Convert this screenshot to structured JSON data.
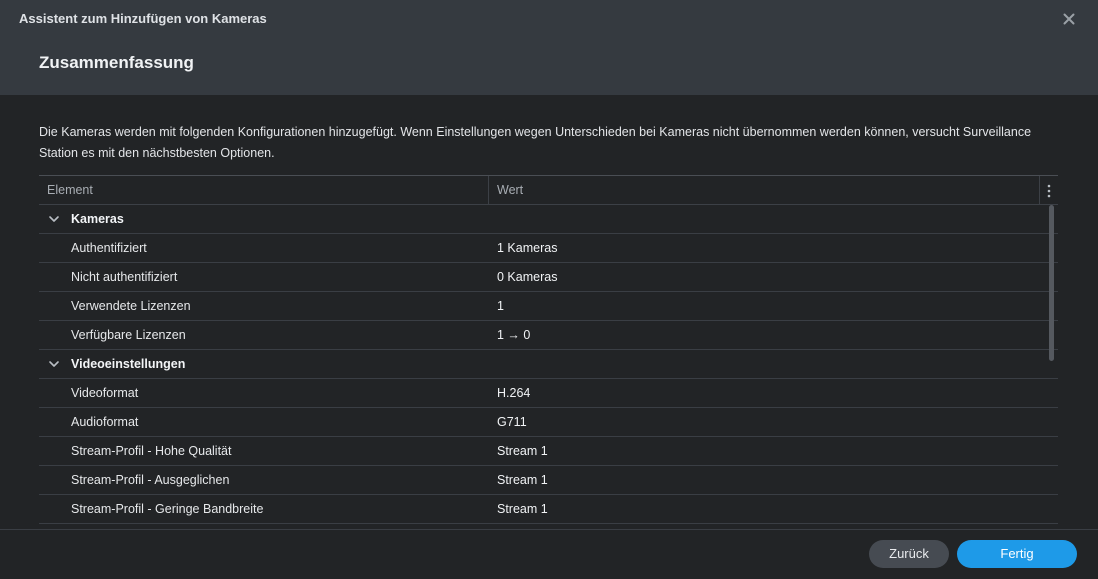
{
  "window": {
    "title": "Assistent zum Hinzufügen von Kameras",
    "close_icon": "close-icon"
  },
  "page": {
    "heading": "Zusammenfassung",
    "description": "Die Kameras werden mit folgenden Konfigurationen hinzugefügt. Wenn Einstellungen wegen Unterschieden bei Kameras nicht übernommen werden können, versucht Surveillance Station es mit den nächstbesten Optionen."
  },
  "table": {
    "columns": {
      "element": "Element",
      "value": "Wert"
    },
    "menu_icon": "more-vertical-icon",
    "groups": [
      {
        "label": "Kameras",
        "rows": [
          {
            "name": "Authentifiziert",
            "value": "1 Kameras"
          },
          {
            "name": "Nicht authentifiziert",
            "value": "0 Kameras"
          },
          {
            "name": "Verwendete Lizenzen",
            "value": "1"
          },
          {
            "name": "Verfügbare Lizenzen",
            "value": "1 → 0"
          }
        ]
      },
      {
        "label": "Videoeinstellungen",
        "rows": [
          {
            "name": "Videoformat",
            "value": "H.264"
          },
          {
            "name": "Audioformat",
            "value": "G711"
          },
          {
            "name": "Stream-Profil - Hohe Qualität",
            "value": "Stream 1"
          },
          {
            "name": "Stream-Profil - Ausgeglichen",
            "value": "Stream 1"
          },
          {
            "name": "Stream-Profil - Geringe Bandbreite",
            "value": "Stream 1"
          }
        ]
      }
    ]
  },
  "footer": {
    "back_label": "Zurück",
    "finish_label": "Fertig"
  },
  "colors": {
    "accent": "#1e9ae8",
    "titlebar": "#353a40",
    "background": "#222426"
  }
}
